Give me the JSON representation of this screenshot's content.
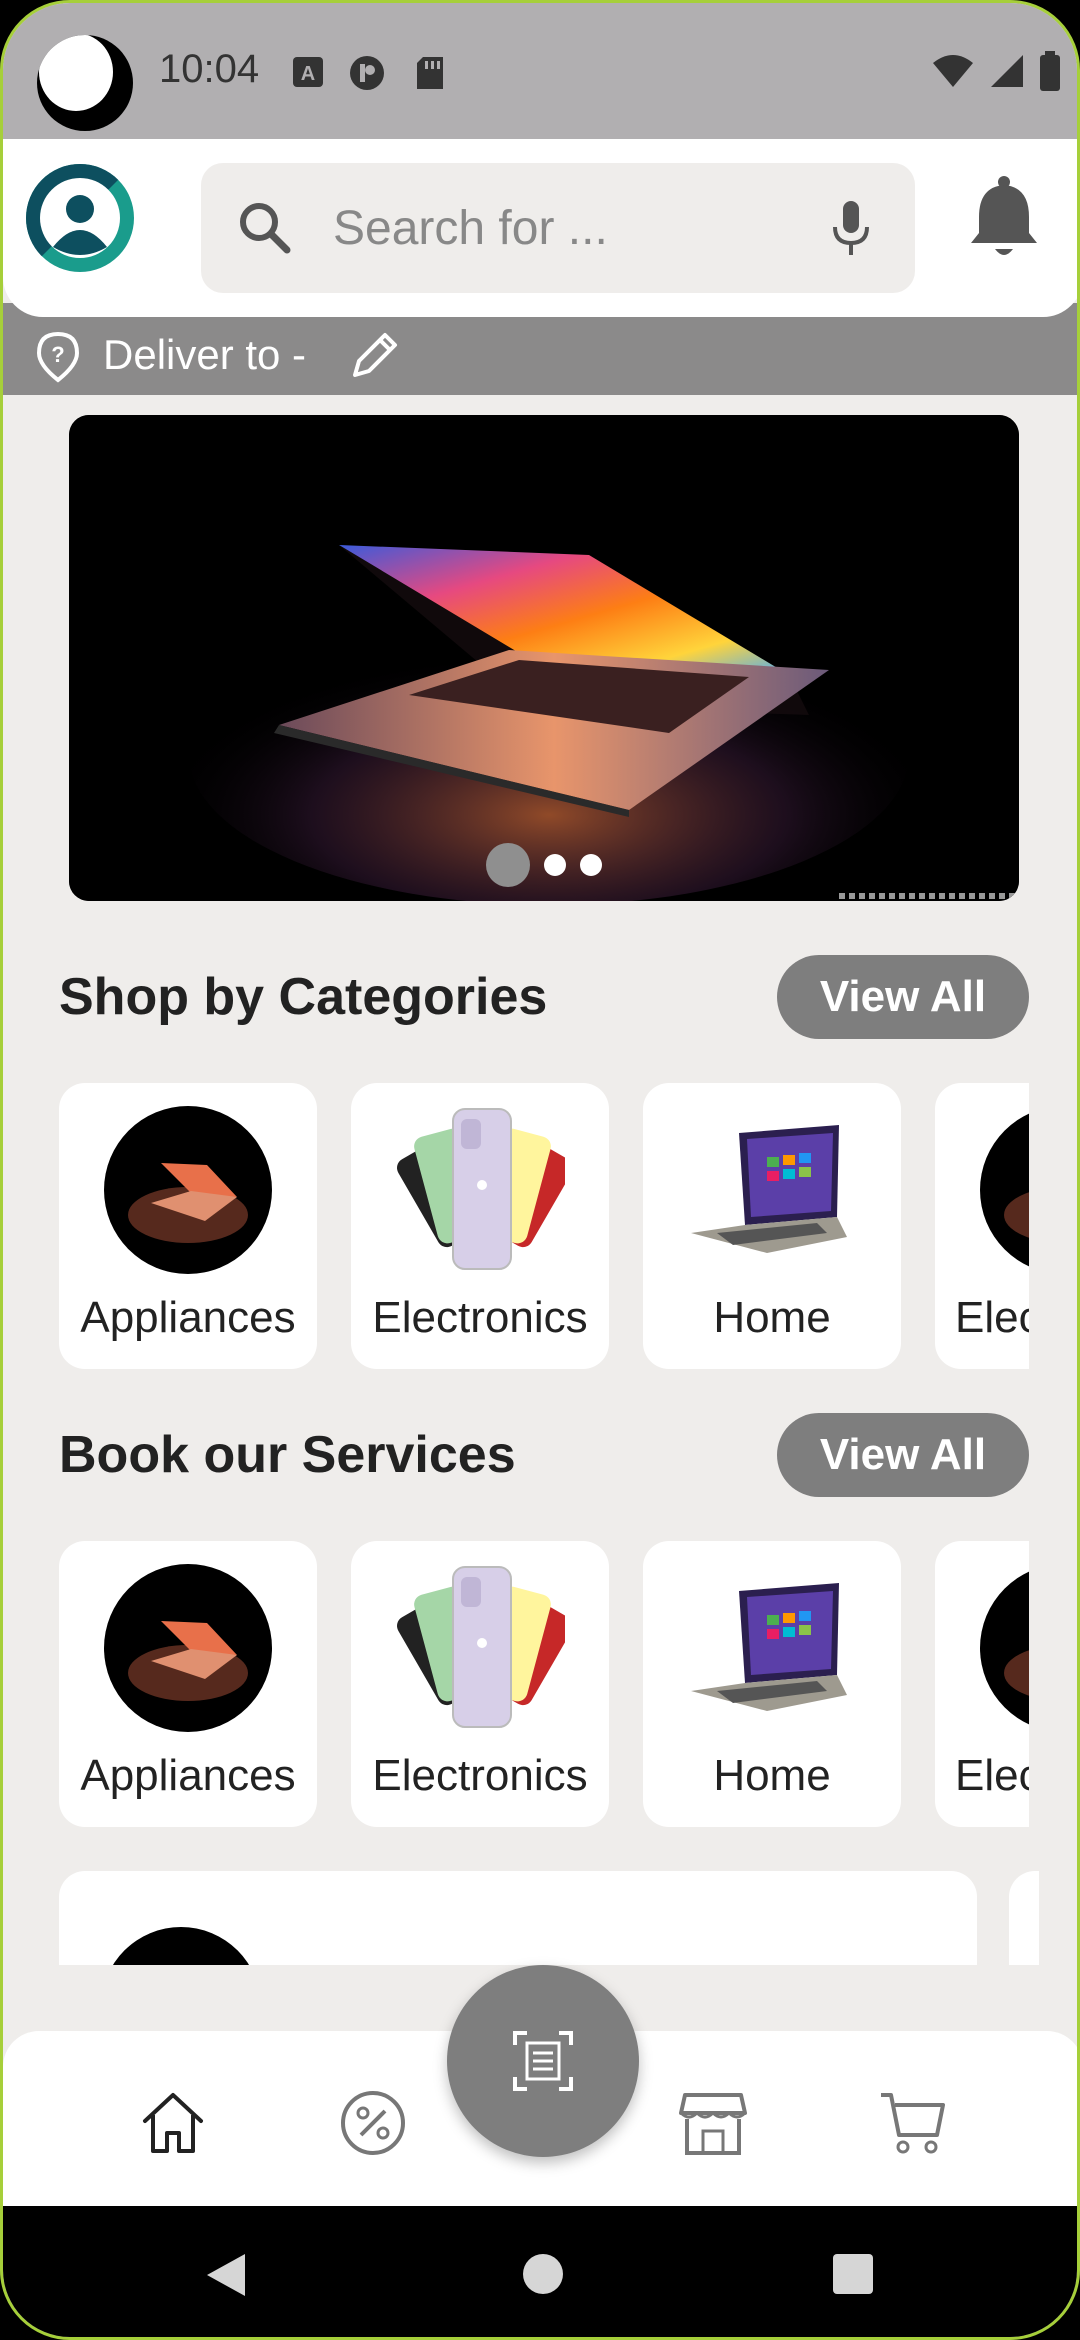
{
  "status_bar": {
    "time": "10:04"
  },
  "header": {
    "search_placeholder": "Search for ...",
    "deliver_label": "Deliver to -"
  },
  "banner": {
    "slide_count": 3,
    "active_slide": 1
  },
  "categories": {
    "title": "Shop by Categories",
    "view_all_label": "View All",
    "items": [
      {
        "label": "Appliances",
        "image": "laptop-circle-image"
      },
      {
        "label": "Electronics",
        "image": "phones-image"
      },
      {
        "label": "Home",
        "image": "laptop-image"
      },
      {
        "label": "Elec",
        "image": "laptop-circle-image"
      }
    ]
  },
  "services": {
    "title": "Book our Services",
    "view_all_label": "View All",
    "items": [
      {
        "label": "Appliances",
        "image": "laptop-circle-image"
      },
      {
        "label": "Electronics",
        "image": "phones-image"
      },
      {
        "label": "Home",
        "image": "laptop-image"
      },
      {
        "label": "Elec",
        "image": "laptop-circle-image"
      }
    ]
  },
  "bottom_nav": {
    "items": [
      "home-icon",
      "offers-icon",
      "scan-icon",
      "store-icon",
      "cart-icon"
    ]
  },
  "colors": {
    "accent_grey": "#7e7e7e",
    "background": "#efedeb",
    "brand_teal": "#0f6b6f"
  }
}
